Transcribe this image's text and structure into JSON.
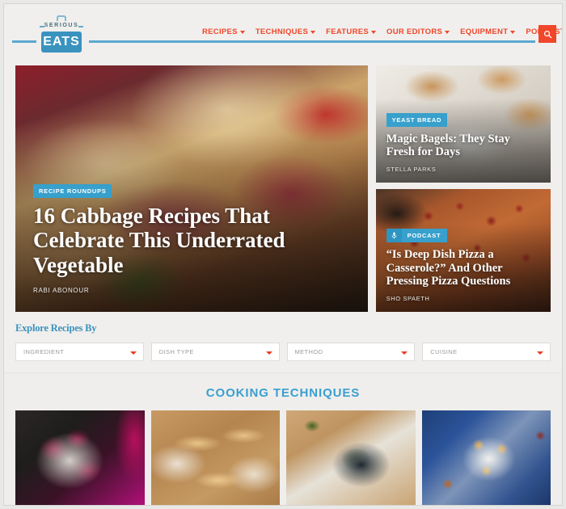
{
  "site": {
    "logo_top": "SERIOUS",
    "logo_bottom": "EATS"
  },
  "nav": {
    "items": [
      {
        "label": "RECIPES",
        "has_caret": true
      },
      {
        "label": "TECHNIQUES",
        "has_caret": true
      },
      {
        "label": "FEATURES",
        "has_caret": true
      },
      {
        "label": "OUR EDITORS",
        "has_caret": true
      },
      {
        "label": "EQUIPMENT",
        "has_caret": true
      },
      {
        "label": "PODCAST",
        "has_caret": false
      }
    ],
    "search_icon": "search-icon",
    "accent_color": "#f0462a",
    "rule_color": "#5aa8d0"
  },
  "hero": {
    "badge": "RECIPE ROUNDUPS",
    "title": "16 Cabbage Recipes That Celebrate This Underrated Vegetable",
    "author": "RABI ABONOUR",
    "badge_color": "#37a0cc"
  },
  "cards": [
    {
      "badge": "YEAST BREAD",
      "title": "Magic Bagels: They Stay Fresh for Days",
      "author": "STELLA PARKS",
      "icon": null
    },
    {
      "badge": "PODCAST",
      "title": "“Is Deep Dish Pizza a Casserole?” And Other Pressing Pizza Questions",
      "author": "SHO SPAETH",
      "icon": "microphone-icon"
    }
  ],
  "explore": {
    "title": "Explore Recipes By",
    "title_color": "#3a93bf",
    "selects": [
      {
        "label": "INGREDIENT"
      },
      {
        "label": "DISH TYPE"
      },
      {
        "label": "METHOD"
      },
      {
        "label": "CUISINE"
      }
    ]
  },
  "techniques": {
    "heading": "COOKING TECHNIQUES",
    "heading_color": "#3a9fd0",
    "items": [
      {
        "name": "radicchio-salad-photo"
      },
      {
        "name": "banh-mi-sandwiches-photo"
      },
      {
        "name": "charred-broccoli-photo"
      },
      {
        "name": "tostadas-photo"
      }
    ]
  }
}
